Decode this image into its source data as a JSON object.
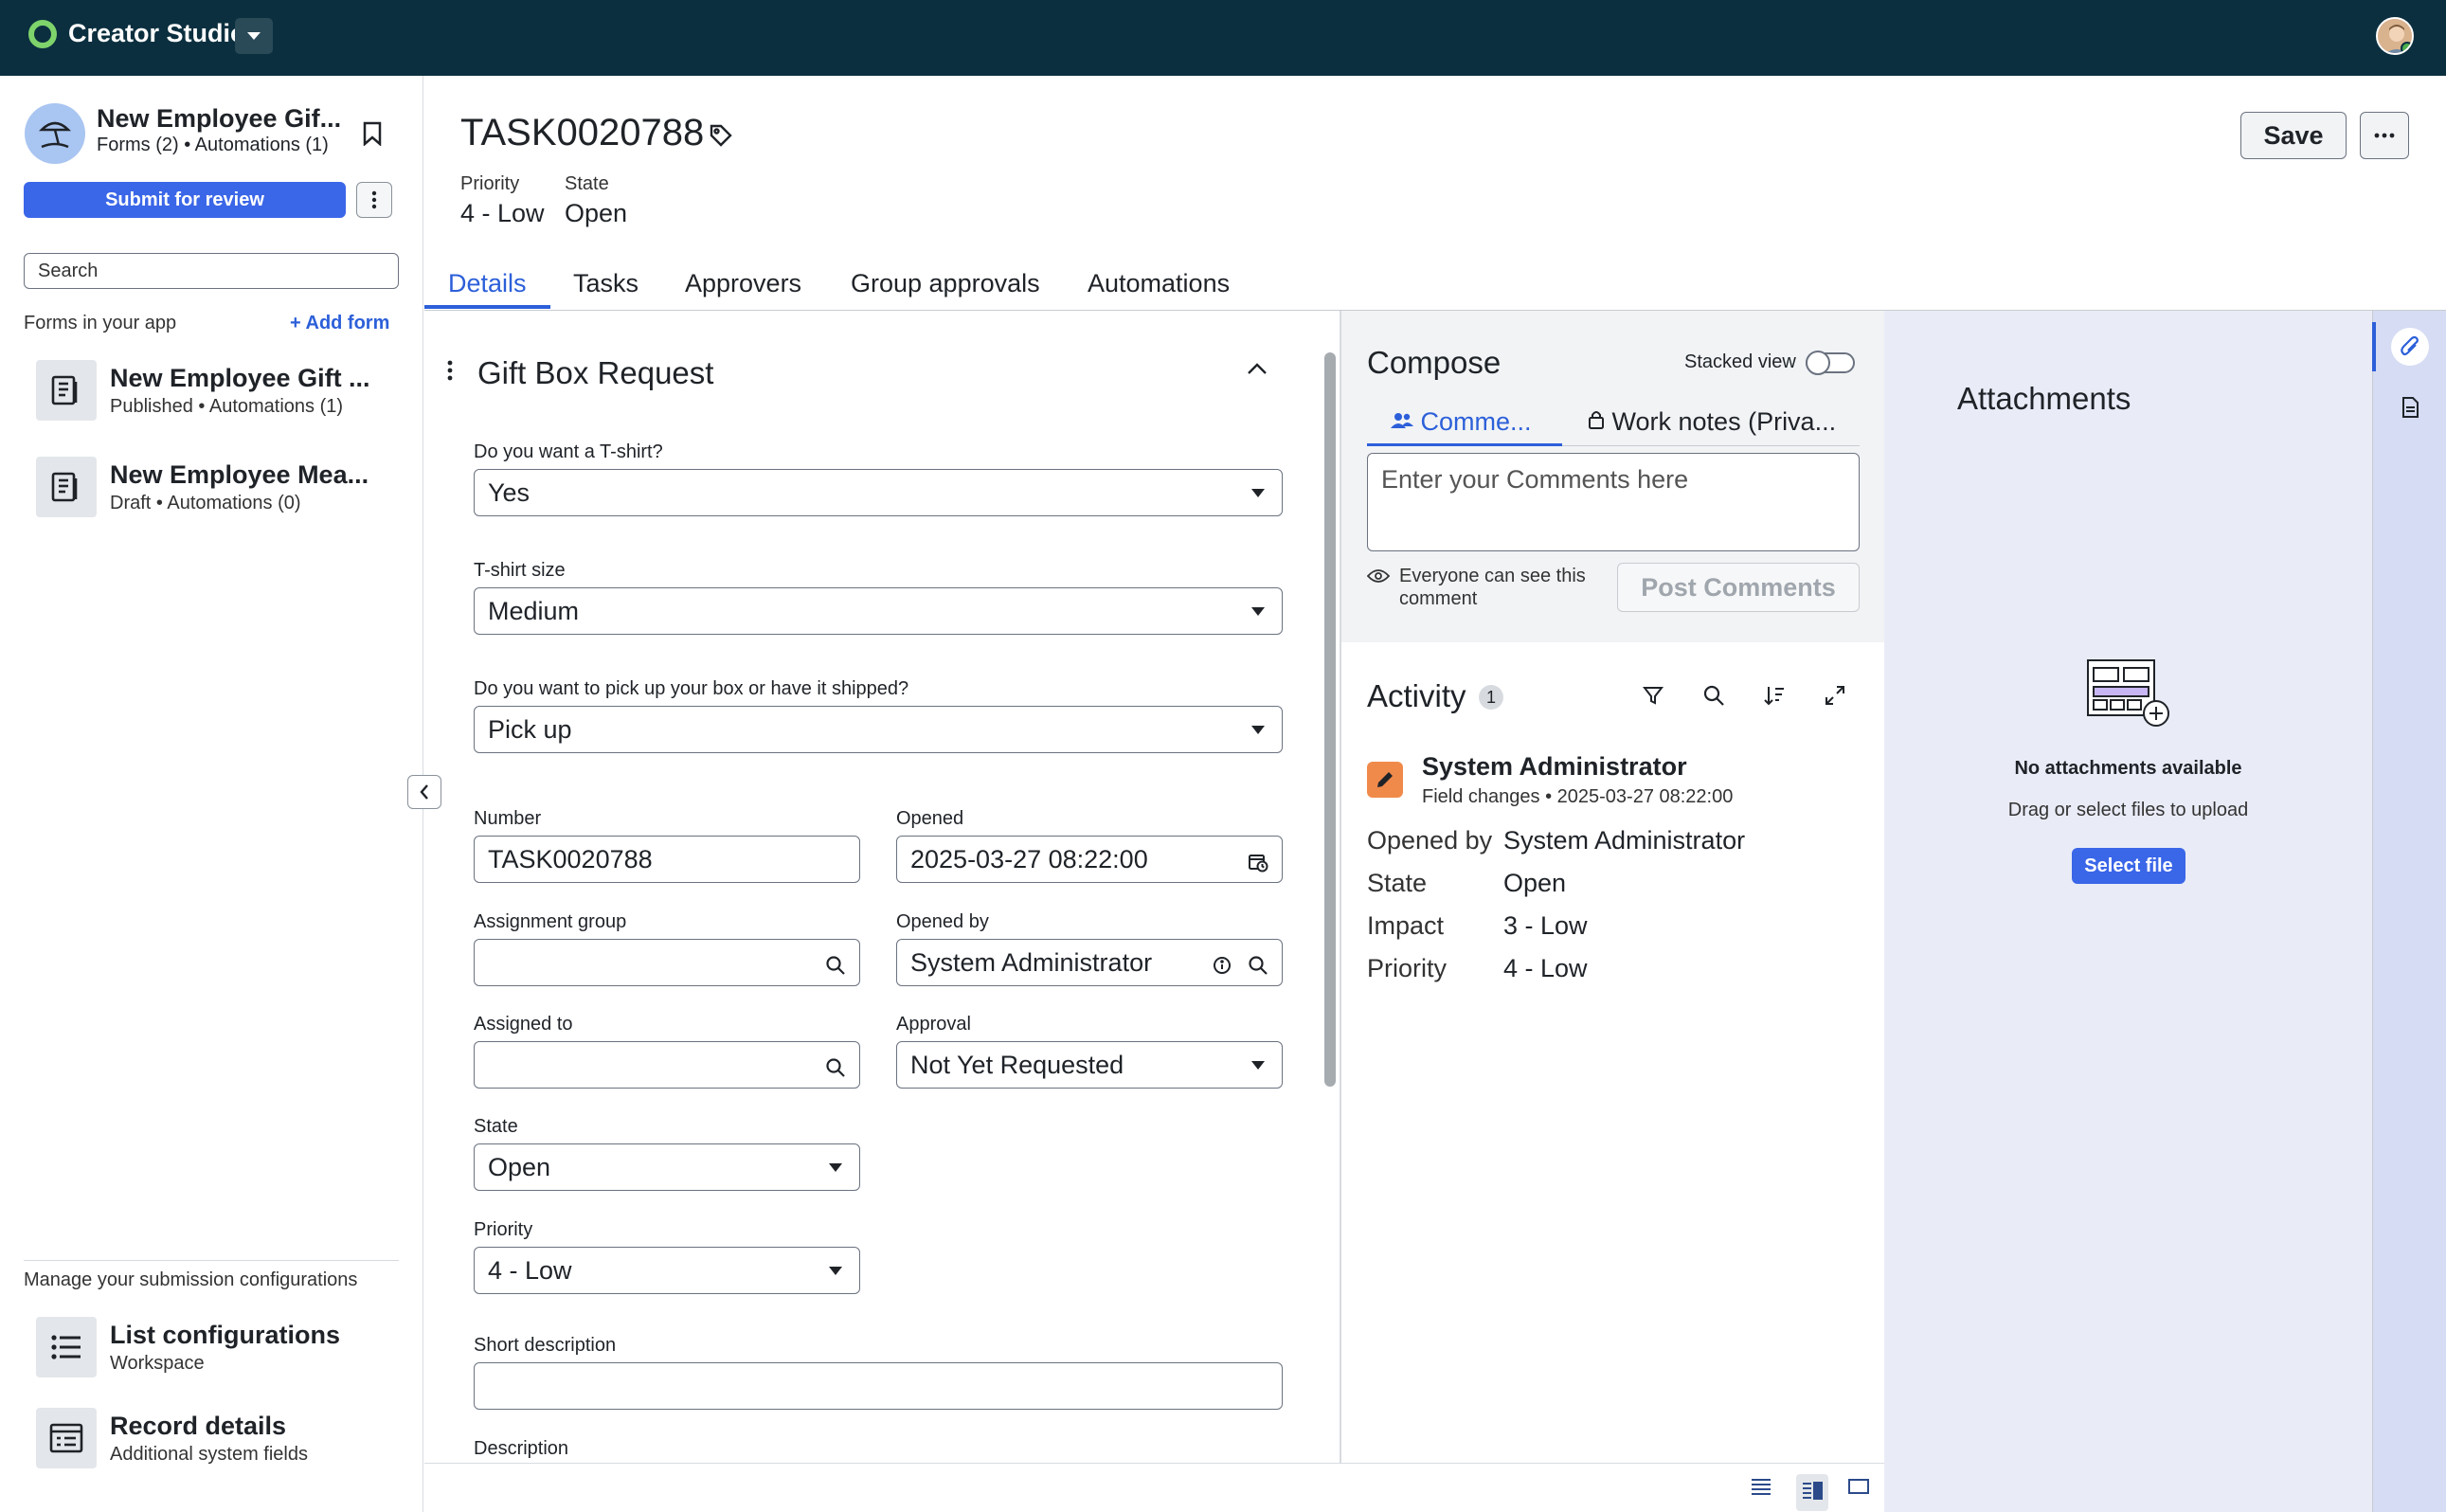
{
  "topbar": {
    "brand": "Creator Studio"
  },
  "sidebar": {
    "app_title": "New Employee Gif...",
    "app_sub": "Forms (2) • Automations (1)",
    "submit_label": "Submit for review",
    "search_placeholder": "Search",
    "forms_label": "Forms in your app",
    "add_form_label": "+ Add form",
    "forms": [
      {
        "title": "New Employee Gift ...",
        "sub": "Published • Automations (1)"
      },
      {
        "title": "New Employee Mea...",
        "sub": "Draft • Automations (0)"
      }
    ],
    "manage_label": "Manage your submission configurations",
    "tools": [
      {
        "title": "List configurations",
        "sub": "Workspace"
      },
      {
        "title": "Record details",
        "sub": "Additional system fields"
      }
    ]
  },
  "header": {
    "task_number": "TASK0020788",
    "priority_label": "Priority",
    "priority_value": "4 - Low",
    "state_label": "State",
    "state_value": "Open",
    "save_label": "Save"
  },
  "tabs": [
    {
      "label": "Details",
      "active": true
    },
    {
      "label": "Tasks"
    },
    {
      "label": "Approvers"
    },
    {
      "label": "Group approvals"
    },
    {
      "label": "Automations"
    }
  ],
  "form": {
    "heading": "Gift Box Request",
    "tshirt_label": "Do you want a T-shirt?",
    "tshirt_value": "Yes",
    "size_label": "T-shirt size",
    "size_value": "Medium",
    "pickup_label": "Do you want to pick up your box or have it shipped?",
    "pickup_value": "Pick up",
    "number_label": "Number",
    "number_value": "TASK0020788",
    "opened_label": "Opened",
    "opened_value": "2025-03-27 08:22:00",
    "assign_group_label": "Assignment group",
    "assign_group_value": "",
    "opened_by_label": "Opened by",
    "opened_by_value": "System Administrator",
    "assigned_to_label": "Assigned to",
    "assigned_to_value": "",
    "approval_label": "Approval",
    "approval_value": "Not Yet Requested",
    "state_label": "State",
    "state_value": "Open",
    "priority_label": "Priority",
    "priority_value": "4 - Low",
    "short_desc_label": "Short description",
    "short_desc_value": "",
    "description_label": "Description"
  },
  "compose": {
    "title": "Compose",
    "stacked_label": "Stacked view",
    "tab_comments": "Comme...",
    "tab_worknotes": "Work notes (Priva...",
    "placeholder": "Enter your Comments here",
    "visibility_text": "Everyone can see this comment",
    "post_label": "Post Comments"
  },
  "activity": {
    "title": "Activity",
    "count": "1",
    "user": "System Administrator",
    "sub": "Field changes • 2025-03-27 08:22:00",
    "rows": [
      {
        "label": "Opened by",
        "value": "System Administrator"
      },
      {
        "label": "State",
        "value": "Open"
      },
      {
        "label": "Impact",
        "value": "3 - Low"
      },
      {
        "label": "Priority",
        "value": "4 - Low"
      }
    ]
  },
  "attachments": {
    "title": "Attachments",
    "empty": "No attachments available",
    "hint": "Drag or select files to upload",
    "select_label": "Select file"
  },
  "colors": {
    "primary": "#3a66e8",
    "topbar": "#0b2f3f",
    "link": "#2c5fd9",
    "attach_bg": "#e9ecf7"
  }
}
